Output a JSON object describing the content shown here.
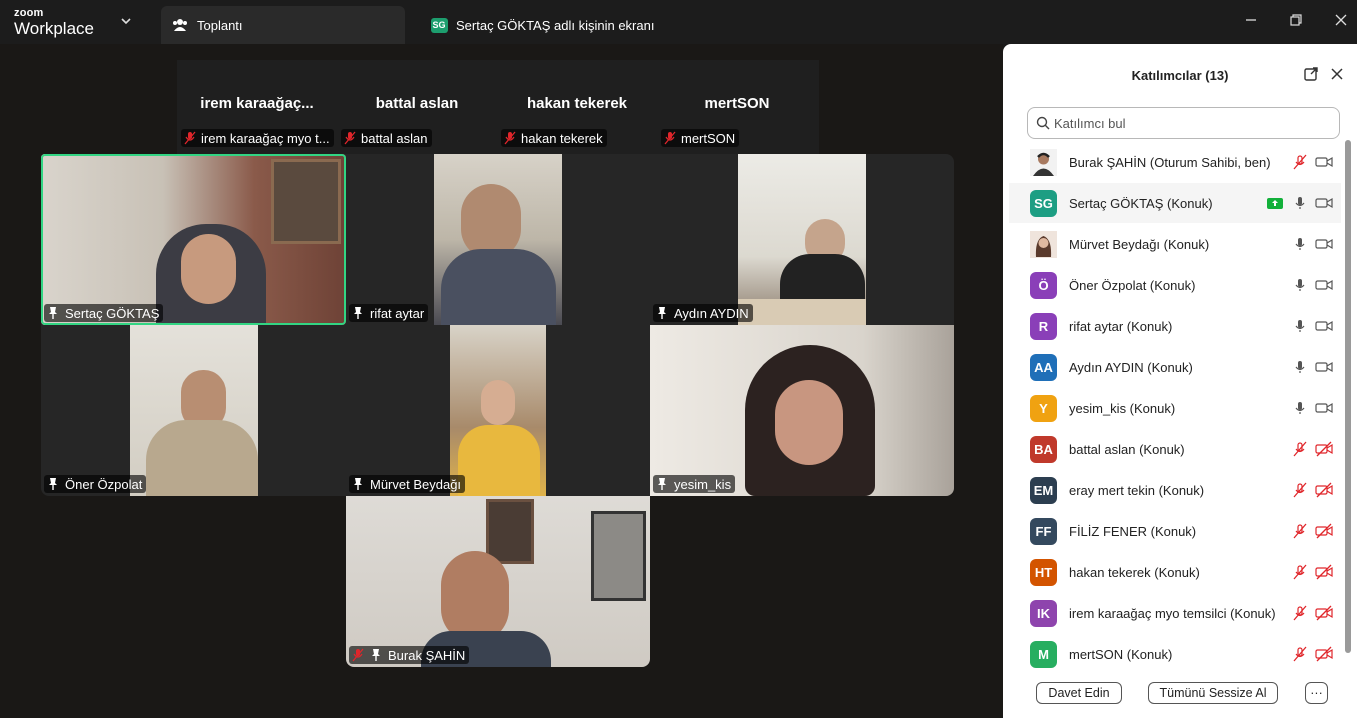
{
  "app": {
    "brand_top": "zoom",
    "brand_bottom": "Workplace"
  },
  "tabs": [
    {
      "label": "Toplantı",
      "icon": "participants-icon"
    },
    {
      "label": "Sertaç GÖKTAŞ adlı kişinin ekranı",
      "badge": "SG",
      "icon": "screen-share-badge"
    }
  ],
  "strip": [
    {
      "display": "irem  karaağaç...",
      "label": "irem karaağaç myo t..."
    },
    {
      "display": "battal aslan",
      "label": "battal aslan"
    },
    {
      "display": "hakan tekerek",
      "label": "hakan tekerek"
    },
    {
      "display": "mertSON",
      "label": "mertSON"
    }
  ],
  "video_tiles": [
    {
      "name": "Sertaç GÖKTAŞ",
      "active": true
    },
    {
      "name": "rifat aytar"
    },
    {
      "name": "Aydın AYDIN"
    },
    {
      "name": "Öner Özpolat"
    },
    {
      "name": "Mürvet Beydağı"
    },
    {
      "name": "yesim_kis"
    },
    {
      "name": "Burak ŞAHİN",
      "muted": true
    }
  ],
  "panel": {
    "title": "Katılımcılar (13)",
    "search_placeholder": "Katılımcı bul",
    "participants": [
      {
        "name": "Burak ŞAHİN (Oturum Sahibi, ben)",
        "initials": "",
        "color": "#ffffff",
        "mic": "muted",
        "cam": "on",
        "sharing": false
      },
      {
        "name": "Sertaç GÖKTAŞ (Konuk)",
        "initials": "SG",
        "color": "#1d9e83",
        "mic": "on",
        "cam": "on",
        "sharing": true
      },
      {
        "name": "Mürvet Beydağı (Konuk)",
        "initials": "",
        "color": "#c89f8a",
        "mic": "on",
        "cam": "on",
        "sharing": false
      },
      {
        "name": "Öner Özpolat (Konuk)",
        "initials": "Ö",
        "color": "#8a3fb8",
        "mic": "on",
        "cam": "on",
        "sharing": false
      },
      {
        "name": "rifat aytar (Konuk)",
        "initials": "R",
        "color": "#8a3fb8",
        "mic": "on",
        "cam": "on",
        "sharing": false
      },
      {
        "name": "Aydın AYDIN (Konuk)",
        "initials": "AA",
        "color": "#1f6fb8",
        "mic": "on",
        "cam": "on",
        "sharing": false
      },
      {
        "name": "yesim_kis (Konuk)",
        "initials": "Y",
        "color": "#f0a211",
        "mic": "on",
        "cam": "on",
        "sharing": false
      },
      {
        "name": "battal aslan (Konuk)",
        "initials": "BA",
        "color": "#c0392b",
        "mic": "muted",
        "cam": "off",
        "sharing": false
      },
      {
        "name": "eray mert tekin (Konuk)",
        "initials": "EM",
        "color": "#2c3e50",
        "mic": "muted",
        "cam": "off",
        "sharing": false
      },
      {
        "name": "FİLİZ FENER (Konuk)",
        "initials": "FF",
        "color": "#34495e",
        "mic": "muted",
        "cam": "off",
        "sharing": false
      },
      {
        "name": "hakan tekerek (Konuk)",
        "initials": "HT",
        "color": "#d35400",
        "mic": "muted",
        "cam": "off",
        "sharing": false
      },
      {
        "name": "irem karaağaç myo temsilci (Konuk)",
        "initials": "IK",
        "color": "#8e44ad",
        "mic": "muted",
        "cam": "off",
        "sharing": false
      },
      {
        "name": "mertSON (Konuk)",
        "initials": "M",
        "color": "#27ae60",
        "mic": "muted",
        "cam": "off",
        "sharing": false
      }
    ],
    "invite_label": "Davet Edin",
    "mute_all_label": "Tümünü Sessize Al",
    "more_label": "···"
  },
  "colors": {
    "active_speaker": "#32d583",
    "muted_red": "#e0262b",
    "panel_bg": "#ffffff"
  }
}
